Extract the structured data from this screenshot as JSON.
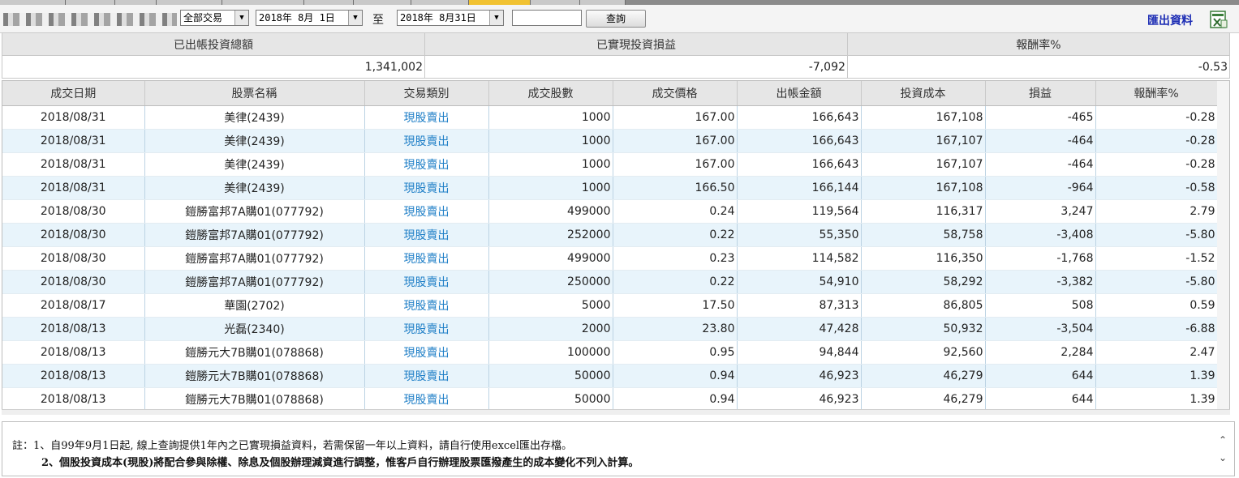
{
  "toolbar": {
    "trade_type": "全部交易",
    "start_date": "2018年 8月 1日",
    "to_label": "至",
    "end_date": "2018年 8月31日",
    "query_label": "查詢",
    "export_label": "匯出資料"
  },
  "summary": {
    "headers": [
      "已出帳投資總額",
      "已實現投資損益",
      "報酬率%"
    ],
    "values": [
      "1,341,002",
      "-7,092",
      "-0.53"
    ]
  },
  "grid": {
    "headers": [
      "成交日期",
      "股票名稱",
      "交易類別",
      "成交股數",
      "成交價格",
      "出帳金額",
      "投資成本",
      "損益",
      "報酬率%"
    ],
    "rows": [
      [
        "2018/08/31",
        "美律(2439)",
        "現股賣出",
        "1000",
        "167.00",
        "166,643",
        "167,108",
        "-465",
        "-0.28"
      ],
      [
        "2018/08/31",
        "美律(2439)",
        "現股賣出",
        "1000",
        "167.00",
        "166,643",
        "167,107",
        "-464",
        "-0.28"
      ],
      [
        "2018/08/31",
        "美律(2439)",
        "現股賣出",
        "1000",
        "167.00",
        "166,643",
        "167,107",
        "-464",
        "-0.28"
      ],
      [
        "2018/08/31",
        "美律(2439)",
        "現股賣出",
        "1000",
        "166.50",
        "166,144",
        "167,108",
        "-964",
        "-0.58"
      ],
      [
        "2018/08/30",
        "鎧勝富邦7A購01(077792)",
        "現股賣出",
        "499000",
        "0.24",
        "119,564",
        "116,317",
        "3,247",
        "2.79"
      ],
      [
        "2018/08/30",
        "鎧勝富邦7A購01(077792)",
        "現股賣出",
        "252000",
        "0.22",
        "55,350",
        "58,758",
        "-3,408",
        "-5.80"
      ],
      [
        "2018/08/30",
        "鎧勝富邦7A購01(077792)",
        "現股賣出",
        "499000",
        "0.23",
        "114,582",
        "116,350",
        "-1,768",
        "-1.52"
      ],
      [
        "2018/08/30",
        "鎧勝富邦7A購01(077792)",
        "現股賣出",
        "250000",
        "0.22",
        "54,910",
        "58,292",
        "-3,382",
        "-5.80"
      ],
      [
        "2018/08/17",
        "華園(2702)",
        "現股賣出",
        "5000",
        "17.50",
        "87,313",
        "86,805",
        "508",
        "0.59"
      ],
      [
        "2018/08/13",
        "光磊(2340)",
        "現股賣出",
        "2000",
        "23.80",
        "47,428",
        "50,932",
        "-3,504",
        "-6.88"
      ],
      [
        "2018/08/13",
        "鎧勝元大7B購01(078868)",
        "現股賣出",
        "100000",
        "0.95",
        "94,844",
        "92,560",
        "2,284",
        "2.47"
      ],
      [
        "2018/08/13",
        "鎧勝元大7B購01(078868)",
        "現股賣出",
        "50000",
        "0.94",
        "46,923",
        "46,279",
        "644",
        "1.39"
      ],
      [
        "2018/08/13",
        "鎧勝元大7B購01(078868)",
        "現股賣出",
        "50000",
        "0.94",
        "46,923",
        "46,279",
        "644",
        "1.39"
      ]
    ]
  },
  "notes": {
    "line1": "註：1、自99年9月1日起, 線上查詢提供1年內之已實現損益資料，若需保留一年以上資料，請自行使用excel匯出存檔。",
    "line2": "2、個股投資成本(現股)將配合參與除權、除息及個股辦理減資進行調整，惟客戶自行辦理股票匯撥產生的成本變化不列入計算。"
  },
  "colors": {
    "link": "#1f7fc7",
    "export": "#1f2fb5",
    "alt_row": "#e8f4fb",
    "header_bg": "#e6e6e6",
    "active_tab": "#f1c232"
  },
  "icons": [
    "chevron-down-icon",
    "excel-icon",
    "scroll-up-icon",
    "scroll-down-icon"
  ]
}
